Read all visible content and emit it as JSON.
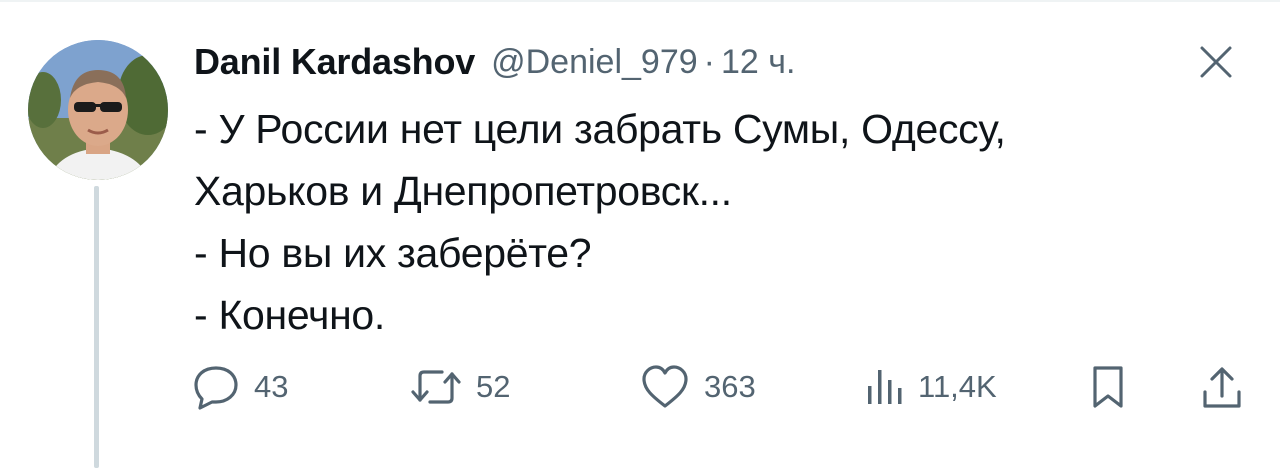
{
  "tweet": {
    "author": {
      "display_name": "Danil Kardashov",
      "handle": "@Deniel_979",
      "avatar_icon": "profile-photo"
    },
    "separator": "·",
    "time": "12 ч.",
    "text_lines": [
      "- У России нет цели забрать Сумы, Одессу,",
      "Харьков и Днепропетровск...",
      "- Но вы их заберёте?",
      "- Конечно."
    ],
    "actions": {
      "reply": {
        "icon": "reply-icon",
        "count": "43"
      },
      "retweet": {
        "icon": "retweet-icon",
        "count": "52"
      },
      "like": {
        "icon": "heart-icon",
        "count": "363"
      },
      "views": {
        "icon": "views-icon",
        "count": "11,4K"
      },
      "bookmark": {
        "icon": "bookmark-icon"
      },
      "share": {
        "icon": "share-icon"
      }
    },
    "close_icon": "close-icon"
  },
  "colors": {
    "text_primary": "#0f1419",
    "text_secondary": "#536471",
    "thread_line": "#cfd9de",
    "divider": "#eff3f4"
  }
}
